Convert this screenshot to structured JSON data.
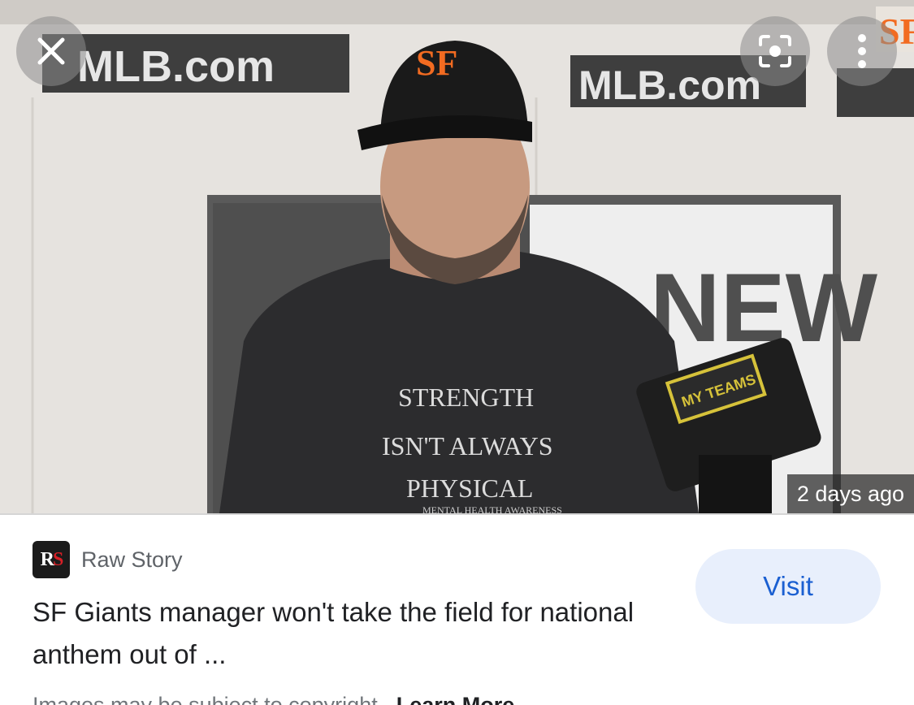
{
  "preview": {
    "time_ago": "2 days ago",
    "close_icon": "close-icon",
    "lens_icon": "lens-search-icon",
    "more_icon": "more-vert-icon",
    "backdrop_text": {
      "banner_left": "MLB.com",
      "banner_right": "MLB.com",
      "side_sign": "NEW"
    },
    "shirt_text": [
      "STRENGTH",
      "ISN'T ALWAYS",
      "PHYSICAL",
      "MENTAL HEALTH AWARENESS"
    ],
    "cap_logo": "SF",
    "mic_flag": "MY TEAMS"
  },
  "card": {
    "source": {
      "logo_text_r": "R",
      "logo_text_s": "S",
      "name": "Raw Story"
    },
    "visit_label": "Visit",
    "headline": "SF Giants manager won't take the field for national anthem out of ...",
    "footnote": "Images may be subject to copyright.",
    "learn_more": "Learn More"
  },
  "colors": {
    "visit_bg": "#e8effc",
    "visit_text": "#1a5fd1",
    "giants_orange": "#f26b21"
  }
}
